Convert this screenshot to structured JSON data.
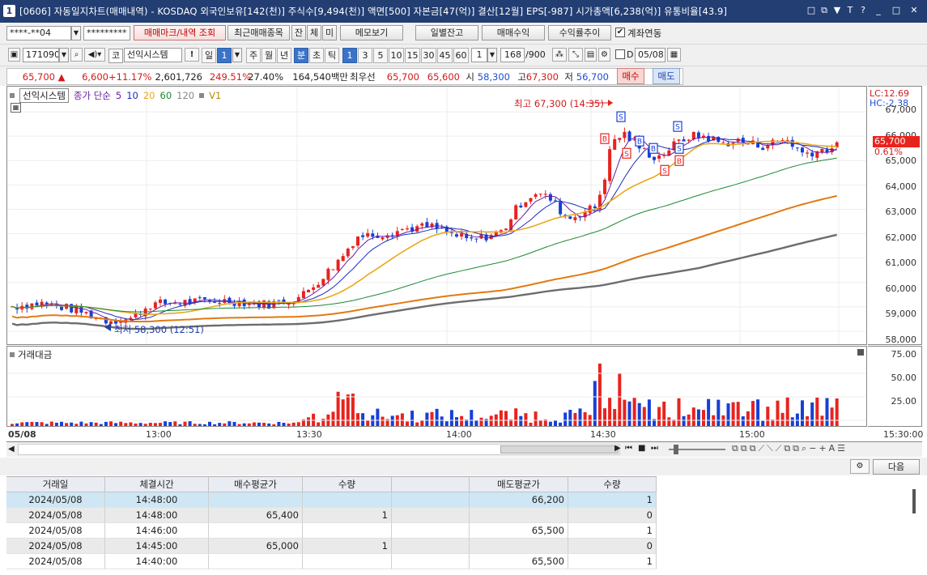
{
  "window": {
    "app_number": "1",
    "title": "[0606] 자동일지차트(매매내역) - KOSDAQ 외국인보유[142(천)] 주식수[9,494(천)] 액면[500] 자본금[47(억)] 결산[12월] EPS[-987] 시가총액[6,238(억)] 유통비율[43.9]",
    "buttons": [
      "□",
      "⧉",
      "▼",
      "T",
      "?",
      "_",
      "□",
      "✕"
    ]
  },
  "toolbar1": {
    "account_value": "****-**04",
    "password_value": "*********",
    "btn_trade_mark": "매매마크/내역 조회",
    "btn_recent": "최근매매종목",
    "btn_jan": "잔",
    "btn_che": "체",
    "btn_mi": "미",
    "btn_memo": "메모보기",
    "btn_daily": "일별잔고",
    "btn_profit": "매매수익",
    "btn_trend": "수익률추이",
    "link_label": "계좌연동",
    "link_checked": true
  },
  "toolbar2": {
    "code": "171090",
    "indicator": "선익시스템",
    "prefix": "코",
    "period_label": "일",
    "period_value": "1",
    "periods": [
      "주",
      "월",
      "년",
      "분",
      "초",
      "틱"
    ],
    "minutes": [
      "1",
      "3",
      "5",
      "10",
      "15",
      "30",
      "45",
      "60"
    ],
    "selected_minute": "1",
    "count_value": "1",
    "bars": "168",
    "bars_total": "/900",
    "date_value": "05/08",
    "d_label": "D"
  },
  "quote": {
    "price": "65,700",
    "arrow": "▲",
    "change": "6,600",
    "change_pct": "+11.17%",
    "volume": "2,601,726",
    "vol_ratio": "249.51%",
    "turnover": "27.40%",
    "amount": "164,540백만",
    "best_label": "최우선",
    "best_ask": "65,700",
    "best_bid": "65,600",
    "open_label": "시",
    "open": "58,300",
    "high_label": "고",
    "high": "67,300",
    "low_label": "저",
    "low": "56,700",
    "buy_label": "매수",
    "sell_label": "매도"
  },
  "chart_legend": {
    "name": "선익시스템",
    "close_label": "종가 단순",
    "ma": [
      "5",
      "10",
      "20",
      "60",
      "120"
    ],
    "v1": "V1",
    "volume_panel_title": "거래대금",
    "lc": "LC:12.69",
    "hc": "HC:-2.38",
    "current_price_tag": "65,700",
    "current_pct_tag": "0.61%",
    "high_annotation": "최고 67,300 (14:35)",
    "low_annotation": "최저 58,300 (12:51)"
  },
  "colors": {
    "up": "#e8231e",
    "down": "#1740d6",
    "ma5": "#6a1fa0",
    "ma10": "#1c2fbf",
    "ma20": "#eaa81b",
    "ma60": "#1c8a32",
    "ma120": "#e27a10",
    "v1": "#6d6d6d"
  },
  "chart_data": {
    "type": "candlestick",
    "ylim": [
      57600,
      67900
    ],
    "y_ticks": [
      "67,000",
      "66,000",
      "65,000",
      "64,000",
      "63,000",
      "62,000",
      "61,000",
      "60,000",
      "59,000",
      "58,000"
    ],
    "vol_ticks": [
      "75.00",
      "50.00",
      "25.00"
    ],
    "x_ticks": [
      "05/08",
      "13:00",
      "13:30",
      "14:00",
      "14:30",
      "15:00",
      "15:30:00"
    ],
    "annotations": [
      "최고 67,300 (14:35)",
      "최저 58,300 (12:51)"
    ],
    "trade_marks": [
      "B",
      "S",
      "S",
      "B",
      "S",
      "B",
      "S",
      "B",
      "S"
    ],
    "series": [
      {
        "name": "종가 단순 5"
      },
      {
        "name": "10"
      },
      {
        "name": "20"
      },
      {
        "name": "60"
      },
      {
        "name": "120"
      },
      {
        "name": "V1"
      }
    ]
  },
  "grid_toolbar": {
    "next_label": "다음"
  },
  "trade_table": {
    "headers": [
      "거래일",
      "체결시간",
      "매수평균가",
      "수량",
      "",
      "매도평균가",
      "수량"
    ],
    "rows": [
      [
        "2024/05/08",
        "14:48:00",
        "",
        "",
        "",
        "66,200",
        "1"
      ],
      [
        "2024/05/08",
        "14:48:00",
        "65,400",
        "1",
        "",
        "",
        "0"
      ],
      [
        "2024/05/08",
        "14:46:00",
        "",
        "",
        "",
        "65,500",
        "1"
      ],
      [
        "2024/05/08",
        "14:45:00",
        "65,000",
        "1",
        "",
        "",
        "0"
      ],
      [
        "2024/05/08",
        "14:40:00",
        "",
        "",
        "",
        "65,500",
        "1"
      ]
    ]
  }
}
